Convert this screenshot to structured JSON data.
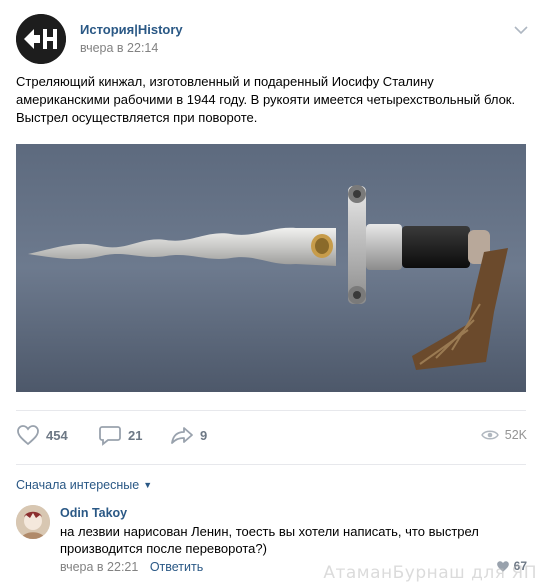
{
  "post": {
    "author": "История|History",
    "time": "вчера в 22:14",
    "text": "Стреляющий кинжал, изготовленный и подаренный Иосифу Сталину американскими рабочими в 1944 году. В рукояти имеется четырехствольный блок. Выстрел осуществляется при повороте.",
    "avatar_logo_text": "CH"
  },
  "actions": {
    "likes": "454",
    "comments": "21",
    "shares": "9",
    "views": "52K"
  },
  "comments_sort": {
    "label": "Сначала интересные"
  },
  "comment": {
    "author": "Odin Takoy",
    "text": "на лезвии нарисован Ленин, тоесть вы хотели написать, что выстрел производится после переворота?)",
    "time": "вчера в 22:21",
    "reply_label": "Ответить",
    "likes": "67"
  },
  "watermark": "АтаманБурнаш для ЯП",
  "colors": {
    "link": "#2a5885",
    "meta": "#828282",
    "icon": "#99a2ad",
    "separator": "#e7e8ec"
  }
}
